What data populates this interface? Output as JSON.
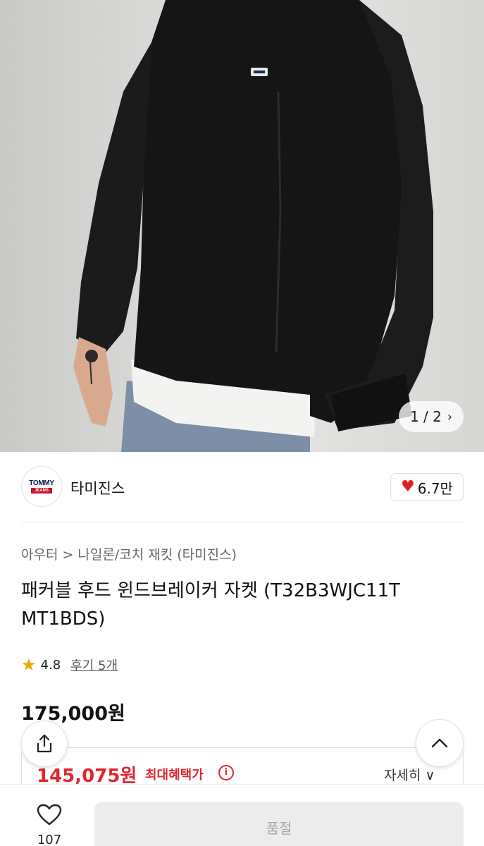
{
  "hero": {
    "image_alt": "black packable hooded windbreaker jacket worn by model",
    "page_indicator": "1 / 2",
    "next_icon": "chevron-right-icon"
  },
  "brand": {
    "logo_line1": "TOMMY",
    "logo_line2": "JEANS",
    "name": "타미진스",
    "like_count": "6.7만",
    "like_icon": "heart-icon"
  },
  "breadcrumb": {
    "category": "아우터",
    "separator": ">",
    "subcategory": "나일론/코치 재킷 (타미진스)"
  },
  "product": {
    "title": "패커블 후드 윈드브레이커 자켓 (T32B3WJC11T MT1BDS)",
    "rating": "4.8",
    "reviews": "후기 5개",
    "price": "175,000원",
    "sale_price": "145,075원",
    "benefit_label": "최대혜택가",
    "detail_label": "자세히 ∨"
  },
  "bottom": {
    "wish_count": "107",
    "soldout_label": "품절"
  },
  "colors": {
    "accent_red": "#e1262e",
    "star": "#f2a600",
    "disabled_bg": "#ececec"
  }
}
